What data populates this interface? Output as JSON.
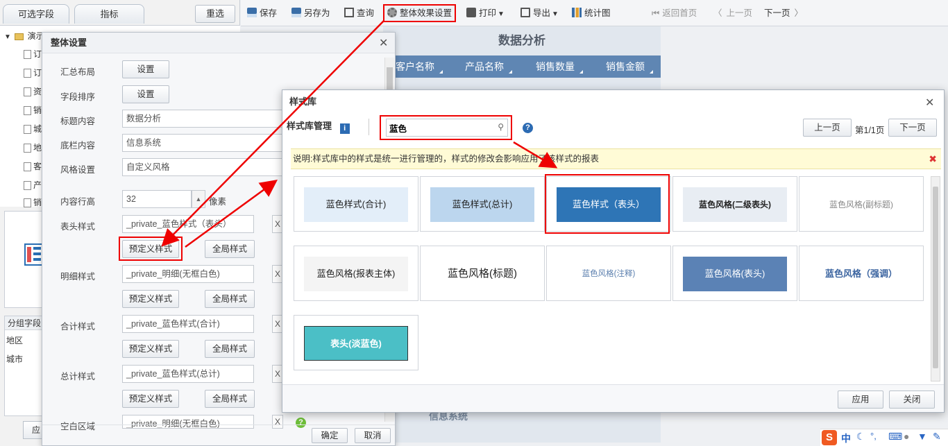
{
  "left_panel": {
    "tab_fields": "可选字段",
    "tab_metrics": "指标",
    "reselect": "重选",
    "tree_root": "演示",
    "tree_items": [
      "订",
      "订",
      "资",
      "销",
      "城",
      "地",
      "客",
      "产",
      "销"
    ],
    "group_header": "分组字段",
    "group_items": [
      "地区",
      "城市"
    ],
    "bottom_btn": "应"
  },
  "toolbar": {
    "save": "保存",
    "save_as": "另存为",
    "query": "查询",
    "overall_effect": "整体效果设置",
    "print": "打印",
    "export": "导出",
    "chart": "统计图",
    "home": "返回首页",
    "prev": "上一页",
    "next": "下一页"
  },
  "report": {
    "title": "数据分析",
    "columns": [
      "客户名称",
      "产品名称",
      "销售数量",
      "销售金额"
    ],
    "footer": "信息系统"
  },
  "settings_dialog": {
    "title": "整体设置",
    "summary_layout": {
      "label": "汇总布局",
      "button": "设置"
    },
    "field_sort": {
      "label": "字段排序",
      "button": "设置"
    },
    "title_content": {
      "label": "标题内容",
      "value": "数据分析"
    },
    "footer_content": {
      "label": "底栏内容",
      "value": "信息系统"
    },
    "style_setting": {
      "label": "风格设置",
      "value": "自定义风格"
    },
    "row_height": {
      "label": "内容行高",
      "value": "32",
      "unit": "像素"
    },
    "header_style": {
      "label": "表头样式",
      "value": "_private_蓝色样式（表头）"
    },
    "detail_style": {
      "label": "明细样式",
      "value": "_private_明细(无框白色)"
    },
    "subtotal_style": {
      "label": "合计样式",
      "value": "_private_蓝色样式(合计)"
    },
    "total_style": {
      "label": "总计样式",
      "value": "_private_蓝色样式(总计)"
    },
    "blank_area": {
      "label": "空白区域",
      "value": "_private_明细(无框白色)"
    },
    "predefined_btn": "预定义样式",
    "global_btn": "全局样式",
    "clear_x": "X",
    "ok": "确定",
    "cancel": "取消"
  },
  "style_library": {
    "title": "样式库",
    "manage_label": "样式库管理",
    "search_value": "蓝色",
    "prev": "上一页",
    "page_info": "第1/1页",
    "next": "下一页",
    "notice": "说明:样式库中的样式是统一进行管理的，样式的修改会影响应用了该样式的报表",
    "cards": [
      {
        "label": "蓝色样式(合计)",
        "bg": "#e3eef9",
        "fg": "#222222"
      },
      {
        "label": "蓝色样式(总计)",
        "bg": "#bcd6ee",
        "fg": "#222222"
      },
      {
        "label": "蓝色样式（表头）",
        "bg": "#2e75b6",
        "fg": "#ffffff"
      },
      {
        "label": "蓝色风格(二级表头)",
        "bg": "#e8edf3",
        "fg": "#222222"
      },
      {
        "label": "蓝色风格(副标题)",
        "bg": "#ffffff",
        "fg": "#888888"
      },
      {
        "label": "蓝色风格(报表主体)",
        "bg": "#f4f4f4",
        "fg": "#222222"
      },
      {
        "label": "蓝色风格(标题)",
        "bg": "#ffffff",
        "fg": "#222222"
      },
      {
        "label": "蓝色风格(注释)",
        "bg": "#ffffff",
        "fg": "#5b7fae"
      },
      {
        "label": "蓝色风格(表头)",
        "bg": "#5b82b5",
        "fg": "#ffffff"
      },
      {
        "label": "蓝色风格（强调）",
        "bg": "#ffffff",
        "fg": "#3b64a0"
      },
      {
        "label": "表头(淡蓝色)",
        "bg": "#4bbfc6",
        "fg": "#ffffff"
      }
    ],
    "apply": "应用",
    "close": "关闭"
  },
  "tray": {
    "ime": "中"
  }
}
